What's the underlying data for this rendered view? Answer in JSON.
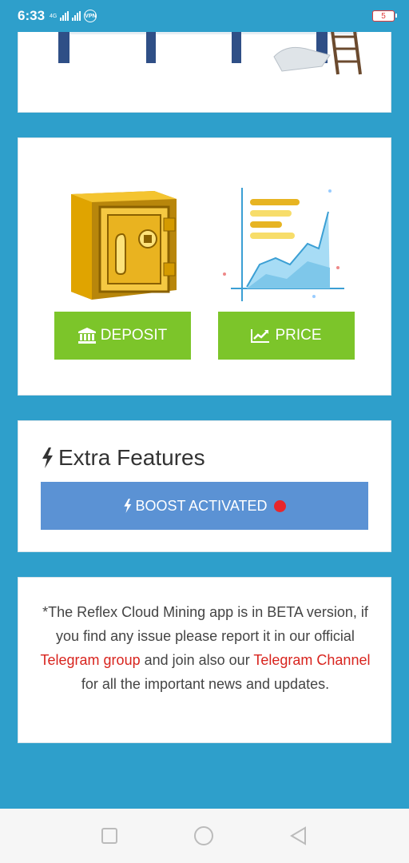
{
  "status_bar": {
    "time": "6:33",
    "network": "4G",
    "vpn": "VPN",
    "battery": "5"
  },
  "actions": {
    "deposit_label": "DEPOSIT",
    "price_label": "PRICE"
  },
  "features": {
    "title": "Extra Features",
    "boost_label": "BOOST ACTIVATED"
  },
  "notice": {
    "part1": "*The Reflex Cloud Mining app is in BETA version, if you find any issue please report it in our official ",
    "link1": "Telegram group",
    "part2": " and join also our ",
    "link2": "Telegram Channel",
    "part3": " for all the important news and updates."
  },
  "colors": {
    "background": "#2e9fcb",
    "green_button": "#7cc52a",
    "boost_button": "#5b92d4",
    "link": "#d8241e",
    "dot": "#e8262c"
  },
  "icons": [
    "bank-icon",
    "line-chart-icon",
    "bolt-icon",
    "safe-illustration",
    "chart-illustration"
  ]
}
